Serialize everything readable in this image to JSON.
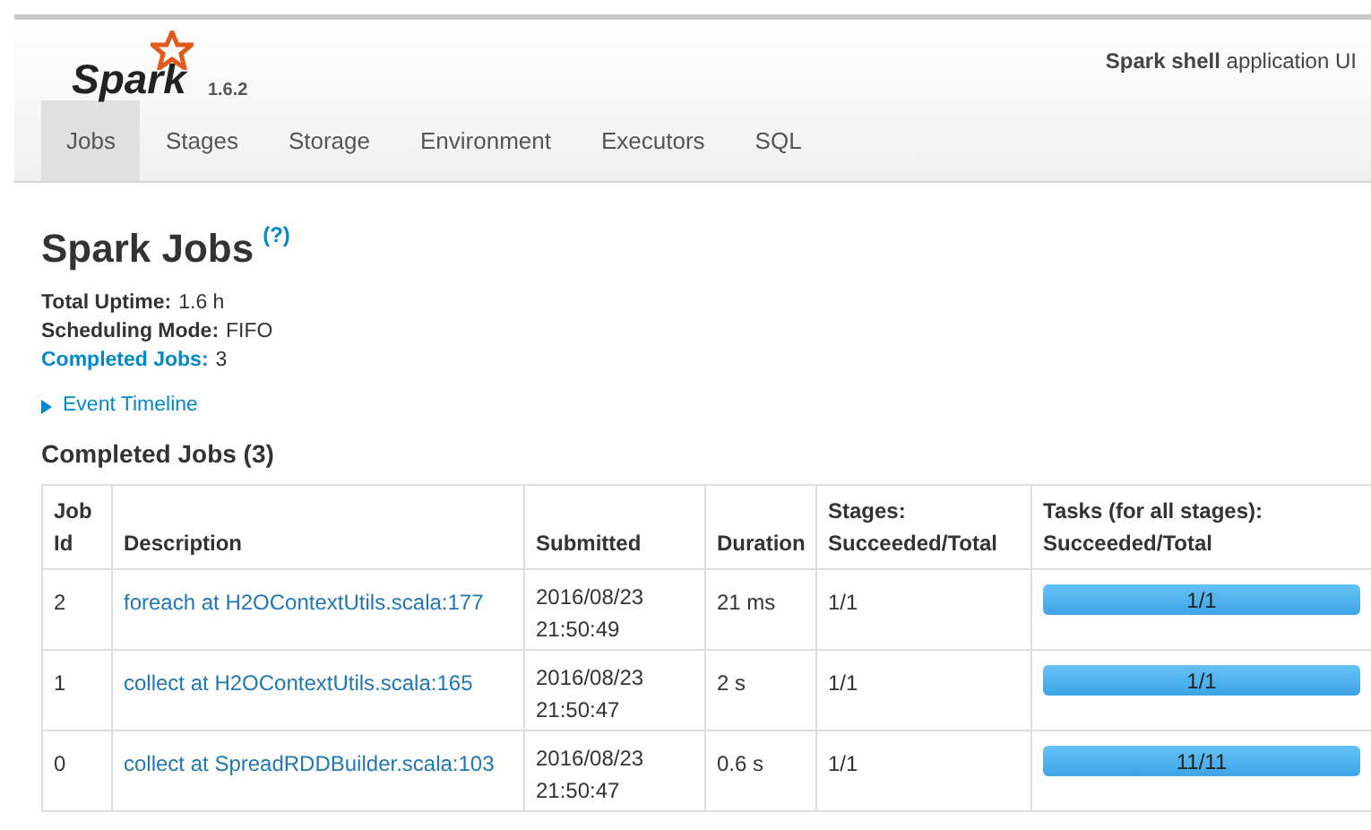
{
  "header": {
    "logo": "Spark",
    "version": "1.6.2",
    "app_name": "Spark shell",
    "app_suffix": "application UI"
  },
  "tabs": [
    {
      "label": "Jobs",
      "selected": true
    },
    {
      "label": "Stages",
      "selected": false
    },
    {
      "label": "Storage",
      "selected": false
    },
    {
      "label": "Environment",
      "selected": false
    },
    {
      "label": "Executors",
      "selected": false
    },
    {
      "label": "SQL",
      "selected": false
    }
  ],
  "page": {
    "title": "Spark Jobs",
    "help": "(?)",
    "summary": [
      {
        "label": "Total Uptime:",
        "value": "1.6 h",
        "kind": "plain"
      },
      {
        "label": "Scheduling Mode:",
        "value": "FIFO",
        "kind": "plain"
      },
      {
        "label": "Completed Jobs:",
        "value": "3",
        "kind": "link"
      }
    ],
    "timeline": {
      "label": "Event Timeline",
      "expanded": false
    }
  },
  "table": {
    "title": "Completed Jobs (3)",
    "columns": [
      [
        "Job",
        "Id"
      ],
      [
        "Description"
      ],
      [
        "Submitted"
      ],
      [
        "Duration"
      ],
      [
        "Stages:",
        "Succeeded/Total"
      ],
      [
        "Tasks (for all stages):",
        "Succeeded/Total"
      ]
    ],
    "rows": [
      {
        "id": "2",
        "description": "foreach at H2OContextUtils.scala:177",
        "submitted": [
          "2016/08/23",
          "21:50:49"
        ],
        "duration": "21 ms",
        "stages": "1/1",
        "tasks": "1/1",
        "level": 1
      },
      {
        "id": "1",
        "description": "collect at H2OContextUtils.scala:165",
        "submitted": [
          "2016/08/23",
          "21:50:47"
        ],
        "duration": "2 s",
        "stages": "1/1",
        "tasks": "1/1",
        "level": 1
      },
      {
        "id": "0",
        "description": "collect at SpreadRDDBuilder.scala:103",
        "submitted": [
          "2016/08/23",
          "21:50:47"
        ],
        "duration": "0.6 s",
        "stages": "1/1",
        "tasks": "11/11",
        "level": 1
      }
    ]
  }
}
